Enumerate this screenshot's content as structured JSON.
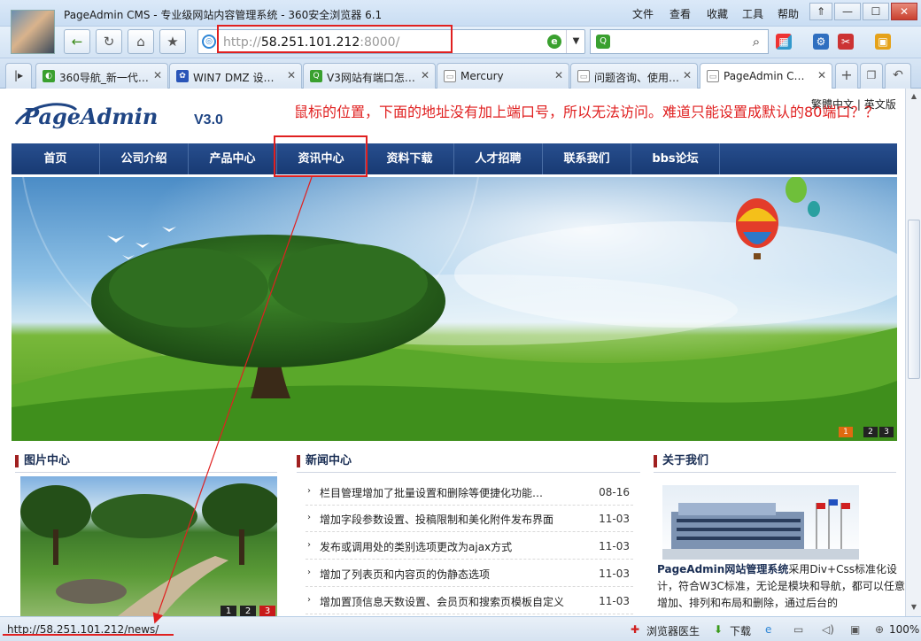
{
  "window": {
    "title": "PageAdmin CMS - 专业级网站内容管理系统 - 360安全浏览器 6.1",
    "menus": [
      "文件",
      "查看",
      "收藏",
      "工具",
      "帮助"
    ],
    "controls": {
      "restore": "⇑",
      "minimize": "—",
      "maximize": "☐",
      "close": "✕"
    }
  },
  "toolbar": {
    "back": "←",
    "refresh": "↻",
    "home": "⌂",
    "favorite": "★",
    "address": {
      "protocol": "http://",
      "host": "58.251.101.212",
      "port": ":8000/"
    },
    "search_value": "",
    "search_glyph": "⌕"
  },
  "tabs": [
    {
      "label": "360导航_新一代…",
      "icon_color": "#3aa02f",
      "active": false
    },
    {
      "label": "WIN7 DMZ 设…",
      "icon_color": "#2a55b8",
      "active": false
    },
    {
      "label": "V3网站有端口怎…",
      "icon_color": "#3aa02f",
      "active": false
    },
    {
      "label": "Mercury",
      "icon_color": "#8a8a8a",
      "active": false
    },
    {
      "label": "问题咨询、使用…",
      "icon_color": "#8a8a8a",
      "active": false
    },
    {
      "label": "PageAdmin C…",
      "icon_color": "#8a8a8a",
      "active": true
    }
  ],
  "site": {
    "logo_text": "PageAdmin",
    "logo_version": "V3.0",
    "lang_links": {
      "traditional": "繁體中文",
      "sep": "|",
      "english": "英文版"
    },
    "annotation": "鼠标的位置，下面的地址没有加上端口号，所以无法访问。难道只能设置成默认的80端口？？",
    "nav": [
      "首页",
      "公司介绍",
      "产品中心",
      "资讯中心",
      "资料下载",
      "人才招聘",
      "联系我们",
      "bbs论坛"
    ],
    "banner_dots": [
      "1",
      "2",
      "3"
    ],
    "sections": {
      "gallery": "图片中心",
      "news": "新闻中心",
      "about": "关于我们"
    },
    "gallery_pages": [
      "1",
      "2",
      "3"
    ],
    "news": [
      {
        "title": "栏目管理增加了批量设置和删除等便捷化功能…",
        "date": "08-16"
      },
      {
        "title": "增加字段参数设置、投稿限制和美化附件发布界面",
        "date": "11-03"
      },
      {
        "title": "发布或调用处的类别选项更改为ajax方式",
        "date": "11-03"
      },
      {
        "title": "增加了列表页和内容页的伪静态选项",
        "date": "11-03"
      },
      {
        "title": "增加置顶信息天数设置、会员页和搜索页模板自定义",
        "date": "11-03"
      }
    ],
    "about_text_bold": "PageAdmin网站管理系统",
    "about_text": "采用Div+Css标准化设计，符合W3C标准，无论是模块和导航，都可以任意增加、排列和布局和删除，通过后台的"
  },
  "statusbar": {
    "url": "http://58.251.101.212/news/",
    "doctor": "浏览器医生",
    "download": "下载",
    "zoom": "100%"
  },
  "colors": {
    "nav_bg": "#1f4584",
    "annotation": "#e02020",
    "section_accent": "#a02020"
  }
}
